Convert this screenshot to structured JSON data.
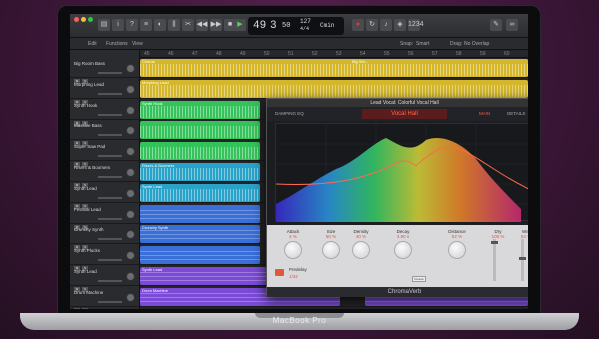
{
  "device": {
    "model": "MacBook Pro"
  },
  "transport": {
    "lcd_bar": "49",
    "lcd_beat": "3",
    "lcd_tempo": "50",
    "lcd_bpm": "127",
    "lcd_key": "Cmin",
    "lcd_sig": "4/4"
  },
  "menu": {
    "edit": "Edit",
    "functions": "Functions",
    "view": "View",
    "snap": "Snap:",
    "snap_value": "Smart",
    "drag": "Drag:",
    "drag_value": "No Overlap"
  },
  "ruler": [
    "45",
    "46",
    "47",
    "48",
    "49",
    "50",
    "51",
    "52",
    "53",
    "54",
    "55",
    "56",
    "57",
    "58",
    "59",
    "60"
  ],
  "tracks": [
    {
      "name": "Big Room Bass"
    },
    {
      "name": "Morphing Lead"
    },
    {
      "name": "Synth Hook"
    },
    {
      "name": "Massive Bass"
    },
    {
      "name": "Super Saw Pad"
    },
    {
      "name": "Risers & Boomers"
    },
    {
      "name": "Synth Lead"
    },
    {
      "name": "Festival Lead"
    },
    {
      "name": "Crunchy Synth"
    },
    {
      "name": "Synth Plucks"
    },
    {
      "name": "Synth Lead"
    },
    {
      "name": "Drum Machine"
    }
  ],
  "regions": {
    "r0a": "Chorus",
    "r0b": "Big Wh...",
    "r1": "Morphing Lead",
    "r2": "Synth Hook",
    "r5": "Risers & Boomers",
    "r6": "Synth Lead",
    "r8": "Crunchy Synth",
    "r10": "Synth Lead",
    "r11a": "Drum Machine",
    "r11b": "Drum Machine"
  },
  "plugin": {
    "window_title": "Lead Vocal: Colorful Vocal Hall",
    "preset": "Vocal Hall",
    "damping_eq": "DAMPING EQ",
    "tab_main": "MAIN",
    "tab_details": "DETAILS",
    "footer": "ChromaVerb",
    "controls": [
      {
        "label": "Attack",
        "value": "4 %"
      },
      {
        "label": "Size",
        "value": "50 %"
      },
      {
        "label": "Density",
        "value": "40 %"
      },
      {
        "label": "Decay",
        "value": "3.90 s"
      },
      {
        "label": "Distance",
        "value": "52 %"
      },
      {
        "label": "Dry",
        "value": "100 %"
      },
      {
        "label": "Wet",
        "value": "54 %"
      }
    ],
    "predelay_label": "Predelay",
    "predelay_value": "1/32",
    "freeze": "Freeze",
    "decay_scale": [
      "0.1",
      "100"
    ]
  },
  "colors": {
    "accent": "#e0573a",
    "yellow_region": "#d4b72a",
    "green_region": "#34c35a",
    "teal_region": "#2aa3c9",
    "blue_region": "#3a6fd8",
    "purple_region": "#7b4bd6"
  }
}
